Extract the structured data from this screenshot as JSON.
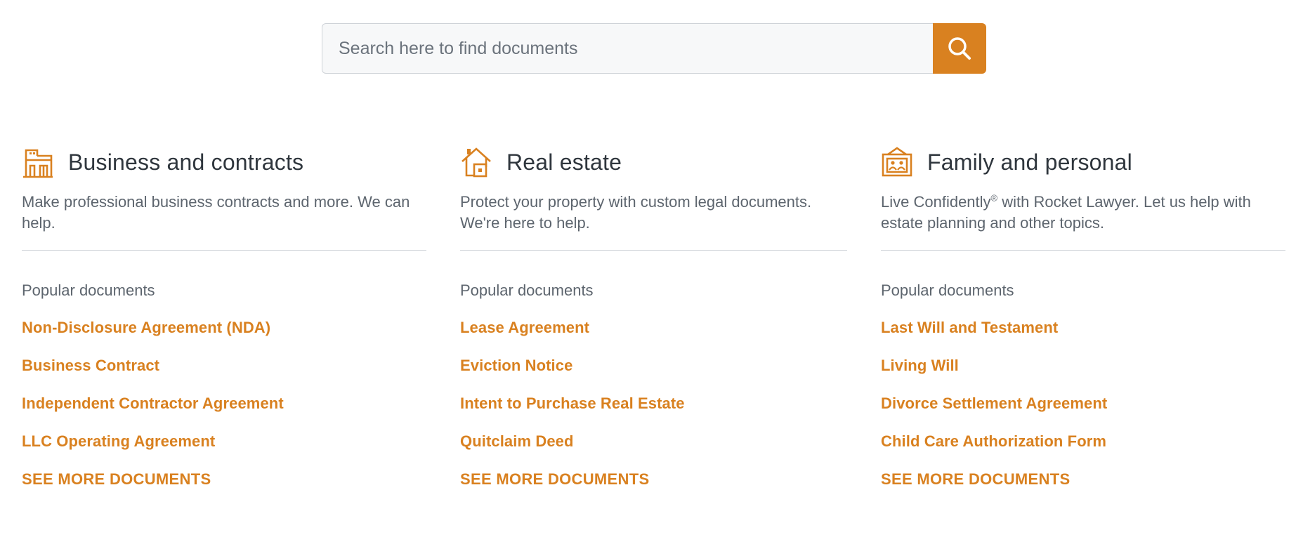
{
  "search": {
    "placeholder": "Search here to find documents",
    "value": "",
    "button_icon": "search-icon"
  },
  "colors": {
    "accent": "#d98120",
    "heading": "#2f363d",
    "muted": "#5d656e",
    "divider": "#cfd3d8",
    "input_bg": "#f7f8f9"
  },
  "columns": [
    {
      "icon": "office-building-icon",
      "title": "Business and contracts",
      "description": "Make professional business contracts and more. We can help.",
      "popular_label": "Popular documents",
      "documents": [
        "Non-Disclosure Agreement (NDA)",
        "Business Contract",
        "Independent Contractor Agreement",
        "LLC Operating Agreement"
      ],
      "see_more": "SEE MORE DOCUMENTS"
    },
    {
      "icon": "house-icon",
      "title": "Real estate",
      "description": "Protect your property with custom legal documents. We're here to help.",
      "popular_label": "Popular documents",
      "documents": [
        "Lease Agreement",
        "Eviction Notice",
        "Intent to Purchase Real Estate",
        "Quitclaim Deed"
      ],
      "see_more": "SEE MORE DOCUMENTS"
    },
    {
      "icon": "family-photo-icon",
      "title": "Family and personal",
      "description_pre": "Live Confidently",
      "description_mark": "®",
      "description_post": " with Rocket Lawyer. Let us help with estate planning and other topics.",
      "popular_label": "Popular documents",
      "documents": [
        "Last Will and Testament",
        "Living Will",
        "Divorce Settlement Agreement",
        "Child Care Authorization Form"
      ],
      "see_more": "SEE MORE DOCUMENTS"
    }
  ]
}
